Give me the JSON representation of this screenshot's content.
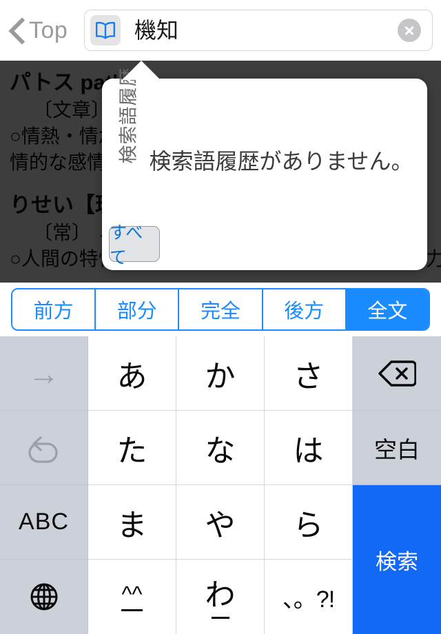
{
  "navbar": {
    "back_label": "Top",
    "back_icon": "chevron-left-icon",
    "dict_icon": "open-book-icon",
    "search_value": "機知",
    "search_placeholder": "",
    "clear_icon": "clear-circle-icon"
  },
  "content": {
    "entries": [
      {
        "head": "パトス pathos",
        "tag": "〔文章〕",
        "lines": [
          "○情熱・情念。また、感",
          "情的な感情を表す語。"
        ]
      },
      {
        "head": "りせい【理性】",
        "tag": "〔常〕  ←→感性",
        "lines": [
          "○人間の特性として認識したり理解したりする能力。ま"
        ]
      }
    ]
  },
  "popover": {
    "vertical_label": "検索語履歴",
    "empty_message": "検索語履歴がありません。",
    "all_button_label": "すべて"
  },
  "segments": {
    "items": [
      {
        "label": "前方",
        "selected": false
      },
      {
        "label": "部分",
        "selected": false
      },
      {
        "label": "完全",
        "selected": false
      },
      {
        "label": "後方",
        "selected": false
      },
      {
        "label": "全文",
        "selected": true
      }
    ]
  },
  "keyboard": {
    "rows": [
      [
        {
          "label": "→",
          "icon": "arrow-right-icon",
          "style": "gray muted"
        },
        {
          "label": "あ",
          "style": ""
        },
        {
          "label": "か",
          "style": ""
        },
        {
          "label": "さ",
          "style": ""
        },
        {
          "label": "",
          "icon": "backspace-icon",
          "style": "gray"
        }
      ],
      [
        {
          "label": "↺",
          "icon": "undo-icon",
          "style": "gray muted"
        },
        {
          "label": "た",
          "style": ""
        },
        {
          "label": "な",
          "style": ""
        },
        {
          "label": "は",
          "style": ""
        },
        {
          "label": "空白",
          "style": "gray small"
        }
      ],
      [
        {
          "label": "ABC",
          "style": "gray abc"
        },
        {
          "label": "ま",
          "style": ""
        },
        {
          "label": "や",
          "style": ""
        },
        {
          "label": "ら",
          "style": ""
        },
        {
          "label": "検索",
          "style": "accent"
        }
      ],
      [
        {
          "label": "",
          "icon": "globe-icon",
          "style": "gray"
        },
        {
          "label": "^^",
          "style": ""
        },
        {
          "label": "わ",
          "style": ""
        },
        {
          "label": "、。?!",
          "style": ""
        }
      ]
    ],
    "search_key_label": "検索",
    "space_key_label": "空白",
    "abc_key_label": "ABC",
    "emoji_key_label": "^^",
    "wa_key_label": "わ",
    "punct_key_label": "、。?!"
  },
  "colors": {
    "accent_blue": "#1169f5",
    "segment_blue": "#1a8cff",
    "key_gray": "#ccd1d9",
    "overlay": "#3b3b3b",
    "muted_text": "#9a9a9f"
  }
}
